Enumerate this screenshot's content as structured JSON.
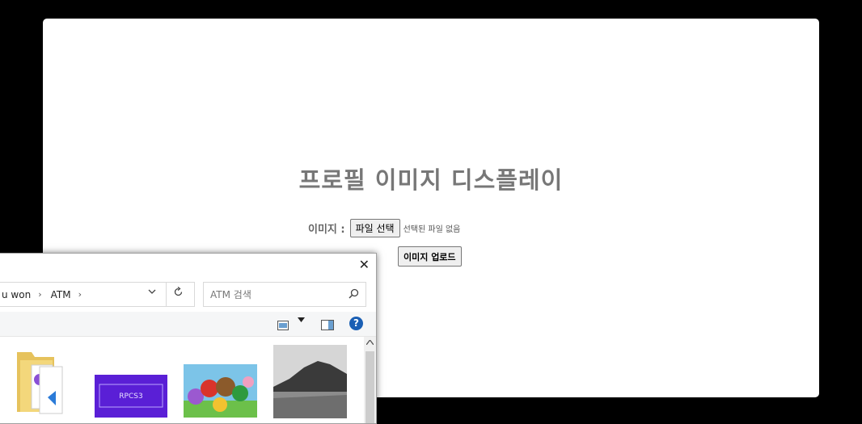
{
  "page": {
    "title": "프로필 이미지 디스플레이",
    "image_label": "이미지 :",
    "file_button": "파일 선택",
    "no_file": "선택된 파일 없음",
    "upload_button": "이미지 업로드"
  },
  "dialog": {
    "close": "✕",
    "breadcrumb": [
      "u won",
      "ATM"
    ],
    "separator": "›",
    "search_placeholder": "ATM 검색",
    "help": "?",
    "thumbnails": [
      "folder",
      "rpcs3",
      "mario-party",
      "landscape"
    ],
    "rpcs3_text": "RPCS3"
  },
  "colors": {
    "background": "#000000",
    "title": "#777777",
    "help_blue": "#1a5fb4",
    "rpcs3_purple": "#5a1fd6"
  }
}
